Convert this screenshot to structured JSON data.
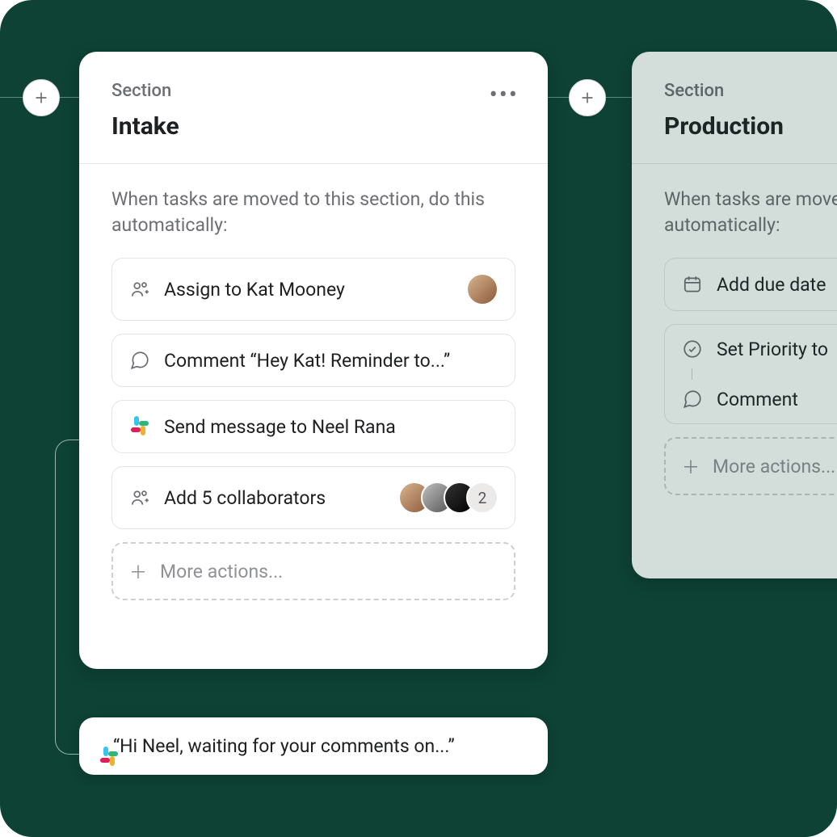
{
  "section_label": "Section",
  "prompt_text": "When tasks are moved to this section, do this automatically:",
  "more_actions_label": "More actions...",
  "primary": {
    "title": "Intake",
    "rules": [
      {
        "icon": "people-add",
        "label": "Assign to Kat Mooney",
        "trailing": "avatar"
      },
      {
        "icon": "comment",
        "label": "Comment “Hey Kat! Reminder to...”"
      },
      {
        "icon": "slack",
        "label": "Send message to Neel Rana"
      },
      {
        "icon": "people-add",
        "label": "Add 5 collaborators",
        "trailing": "avatar-stack",
        "overflow_count": "2"
      }
    ]
  },
  "secondary": {
    "title": "Production",
    "rules_simple": [
      {
        "icon": "calendar",
        "label": "Add due date"
      }
    ],
    "rules_stacked": [
      {
        "icon": "checkcircle",
        "label": "Set Priority to"
      },
      {
        "icon": "comment",
        "label": "Comment"
      }
    ]
  },
  "bubble": {
    "text": "“Hi Neel, waiting for your comments on...”"
  }
}
